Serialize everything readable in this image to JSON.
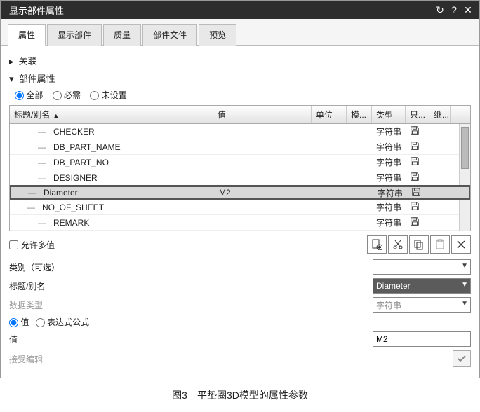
{
  "window": {
    "title": "显示部件属性"
  },
  "tabs": {
    "items": [
      "属性",
      "显示部件",
      "质量",
      "部件文件",
      "预览"
    ],
    "active": 0
  },
  "sections": {
    "assoc": "关联",
    "partAttrs": "部件属性"
  },
  "filter": {
    "all": "全部",
    "required": "必需",
    "unset": "未设置"
  },
  "columns": {
    "name": "标题/别名",
    "value": "值",
    "unit": "单位",
    "model": "模...",
    "type": "类型",
    "readonly": "只...",
    "inherit": "继..."
  },
  "rows": [
    {
      "name": "CHECKER",
      "value": "",
      "type": "字符串",
      "selected": false
    },
    {
      "name": "DB_PART_NAME",
      "value": "",
      "type": "字符串",
      "selected": false
    },
    {
      "name": "DB_PART_NO",
      "value": "",
      "type": "字符串",
      "selected": false
    },
    {
      "name": "DESIGNER",
      "value": "",
      "type": "字符串",
      "selected": false
    },
    {
      "name": "Diameter",
      "value": "M2",
      "type": "字符串",
      "selected": true
    },
    {
      "name": "NO_OF_SHEET",
      "value": "",
      "type": "字符串",
      "selected": false
    },
    {
      "name": "REMARK",
      "value": "",
      "type": "字符串",
      "selected": false
    }
  ],
  "multiValue": "允许多值",
  "form": {
    "categoryLabel": "类别（可选）",
    "titleLabel": "标题/别名",
    "titleValue": "Diameter",
    "dataTypeLabel": "数据类型",
    "dataTypeValue": "字符串",
    "valueModeValue": "值",
    "valueModeExpr": "表达式公式",
    "valueLabel": "值",
    "valueValue": "M2",
    "acceptEditLabel": "接受编辑"
  },
  "caption": "图3　平垫圈3D模型的属性参数"
}
